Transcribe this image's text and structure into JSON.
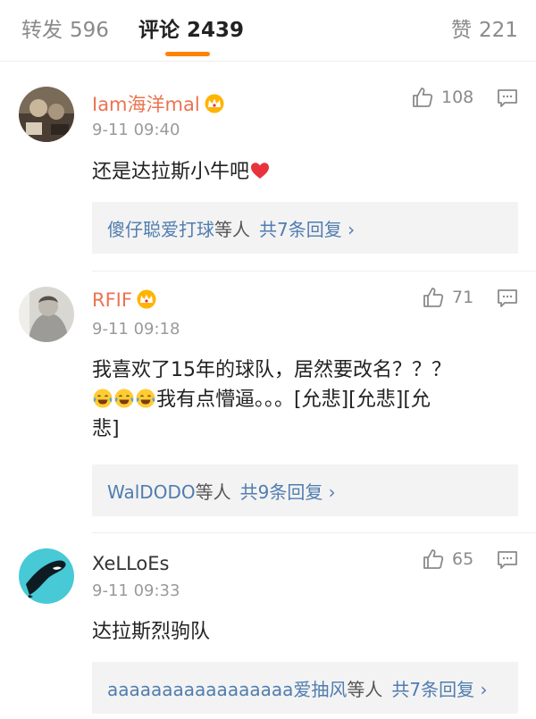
{
  "tabs": {
    "repost": {
      "label": "转发",
      "count": "596"
    },
    "comment": {
      "label": "评论",
      "count": "2439"
    },
    "like": {
      "label": "赞",
      "count": "221"
    }
  },
  "accent_color": "#ff8200",
  "link_color": "#507daf",
  "vip_name_color": "#eb7350",
  "comments": [
    {
      "username": "Iam海洋mal",
      "vip": true,
      "time": "9-11 09:40",
      "text": "还是达拉斯小牛吧",
      "trailing_emoji": "heart",
      "likes": "108",
      "reply_names": "傻仔聪爱打球",
      "reply_mid": "等人",
      "reply_count": "共7条回复 ›"
    },
    {
      "username": "RFIF",
      "vip": true,
      "time": "9-11 09:18",
      "text_line1": "我喜欢了15年的球队，居然要改名？？？",
      "text_line2_rest": "我有点懵逼。。。[允悲][允悲][允",
      "text_line3": "悲]",
      "leading_emoji": "laugh-cry x3",
      "likes": "71",
      "reply_names": "WalDODO",
      "reply_mid": "等人",
      "reply_count": "共9条回复 ›"
    },
    {
      "username": "XeLLoEs",
      "vip": false,
      "time": "9-11 09:33",
      "text": "达拉斯烈驹队",
      "likes": "65",
      "reply_names": "aaaaaaaaaaaaaaaaa爱抽风",
      "reply_mid": "等人",
      "reply_count": "共7条回复 ›"
    }
  ]
}
